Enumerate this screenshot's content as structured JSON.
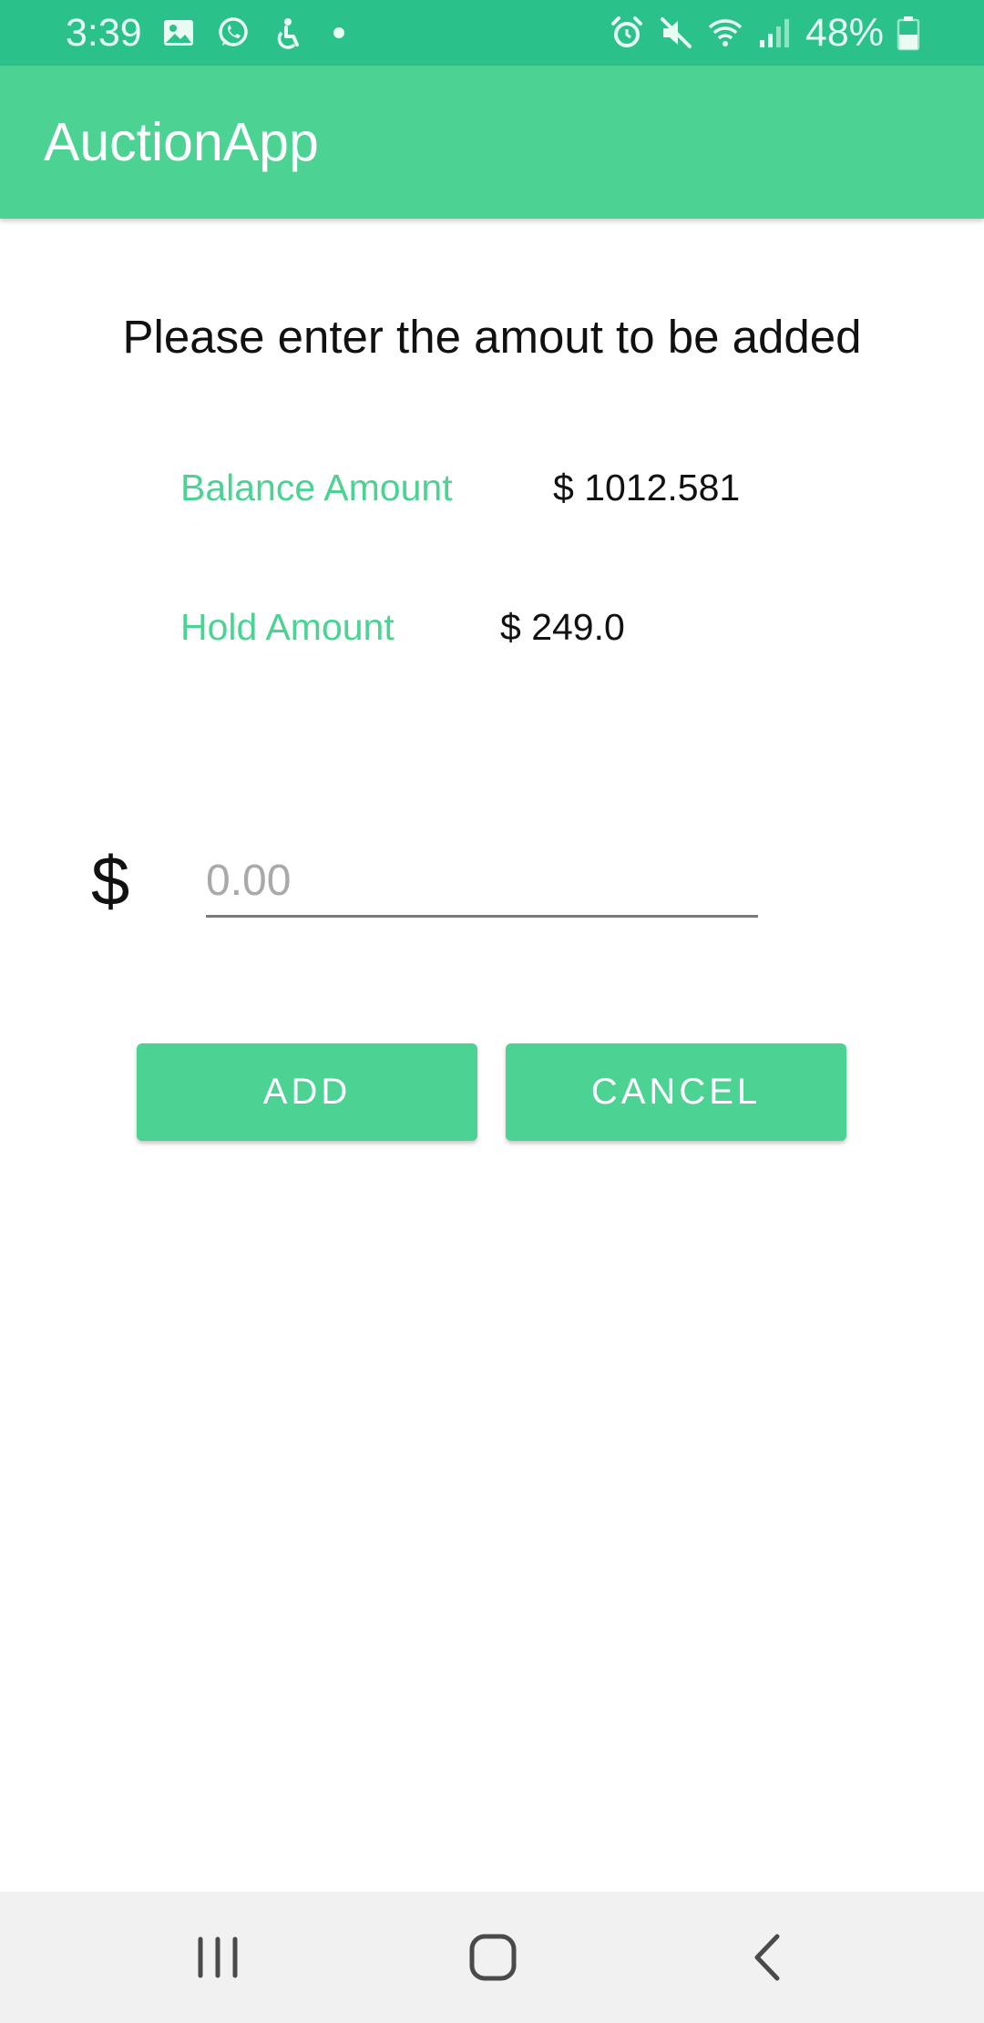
{
  "status_bar": {
    "time": "3:39",
    "battery": "48%",
    "left_icons": [
      "gallery-icon",
      "whatsapp-icon",
      "accessibility-icon",
      "notification-dot"
    ],
    "right_icons": [
      "alarm-icon",
      "mute-icon",
      "wifi-icon",
      "signal-icon",
      "battery-icon"
    ]
  },
  "app_bar": {
    "title": "AuctionApp"
  },
  "content": {
    "prompt": "Please enter the amout to be added",
    "balance_label": "Balance Amount",
    "balance_value": "$ 1012.581",
    "hold_label": "Hold Amount",
    "hold_value": "$ 249.0",
    "currency_symbol": "$",
    "amount_input": {
      "value": "",
      "placeholder": "0.00"
    }
  },
  "actions": {
    "add_label": "ADD",
    "cancel_label": "CANCEL"
  },
  "nav_bar": {
    "icons": [
      "recents-icon",
      "home-icon",
      "back-icon"
    ]
  },
  "colors": {
    "status_bar": "#2ac28a",
    "primary": "#4cd394",
    "text": "#111111",
    "nav_background": "#f1f1f1"
  }
}
